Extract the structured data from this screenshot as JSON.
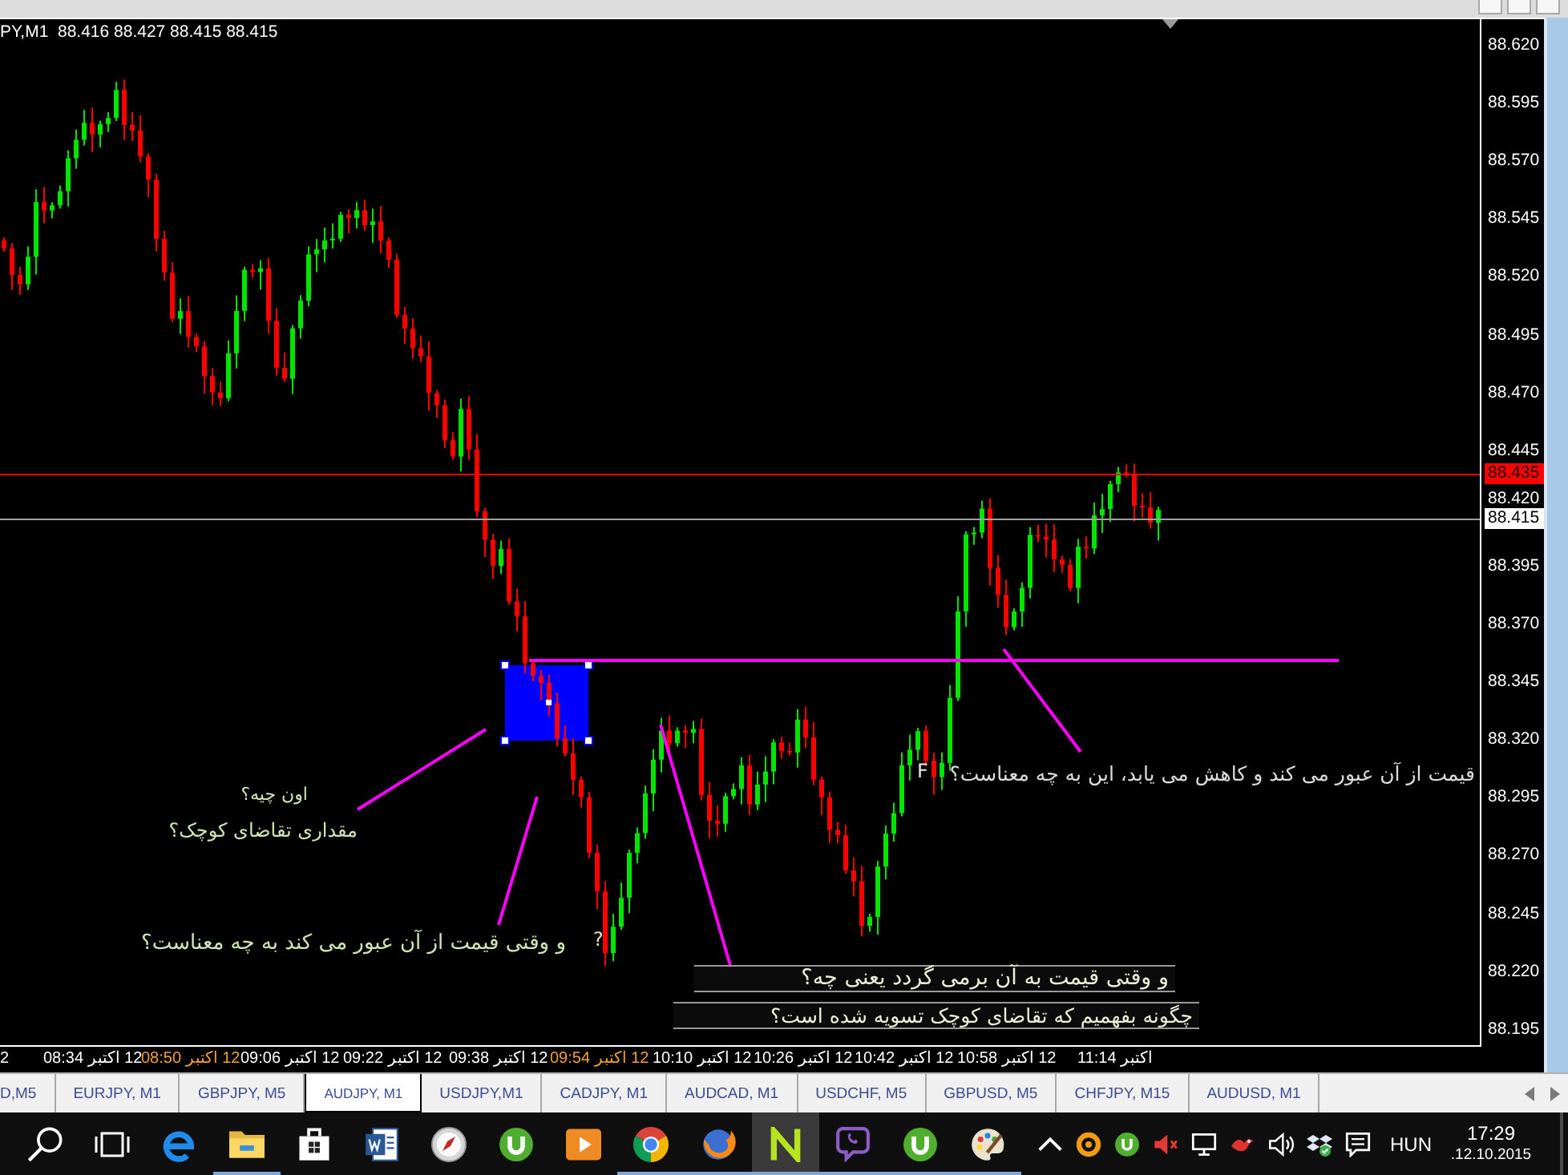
{
  "chart": {
    "title": "PY,M1  88.416 88.427 88.415 88.415",
    "price_ticks": [
      "88.620",
      "88.595",
      "88.570",
      "88.545",
      "88.520",
      "88.495",
      "88.470",
      "88.445",
      "88.420",
      "88.395",
      "88.370",
      "88.345",
      "88.320",
      "88.295",
      "88.270",
      "88.245",
      "88.220",
      "88.195"
    ],
    "price_markers": [
      {
        "kind": "level",
        "label": "88.435"
      },
      {
        "kind": "bid",
        "label": "88.415"
      }
    ],
    "time_labels": [
      {
        "label": "اکتبر 11:14",
        "highlighted": false
      },
      {
        "label": "12 اکتبر 10:58",
        "highlighted": false
      },
      {
        "label": "12 اکتبر 10:42",
        "highlighted": false
      },
      {
        "label": "12 اکتبر 10:26",
        "highlighted": false
      },
      {
        "label": "12 اکتبر 10:10",
        "highlighted": false
      },
      {
        "label": "12 اکتبر 09:54",
        "highlighted": true
      },
      {
        "label": "12 اکتبر 09:38",
        "highlighted": false
      },
      {
        "label": "12 اکتبر 09:22",
        "highlighted": false
      },
      {
        "label": "12 اکتبر 09:06",
        "highlighted": false
      },
      {
        "label": "12 اکتبر 08:50",
        "highlighted": true
      },
      {
        "label": "12 اکتبر 08:34",
        "highlighted": false
      },
      {
        "label": "2",
        "highlighted": false
      }
    ],
    "notes": [
      {
        "kind": "plain",
        "text": "قیمت از آن عبور می کند و کاهش می یابد، این به چه معناست؟"
      },
      {
        "kind": "plain",
        "text": "F"
      },
      {
        "kind": "plain",
        "text": "اون چیه؟"
      },
      {
        "kind": "plain",
        "text": "مقداری تقاضای کوچک؟"
      },
      {
        "kind": "plain",
        "text": "?"
      },
      {
        "kind": "plain",
        "text": "و وقتی قیمت از آن عبور می کند به چه معناست؟"
      },
      {
        "kind": "boxed",
        "text": "و وقتی قیمت به آن برمی گردد یعنی چه؟"
      },
      {
        "kind": "boxed",
        "text": "چگونه بفهمیم که تقاضای کوچک تسویه شده است؟"
      }
    ]
  },
  "tabs": [
    {
      "label": "AUDUSD, M1",
      "selected": false
    },
    {
      "label": "CHFJPY, M15",
      "selected": false
    },
    {
      "label": "GBPUSD, M5",
      "selected": false
    },
    {
      "label": "USDCHF, M5",
      "selected": false
    },
    {
      "label": "AUDCAD, M1",
      "selected": false
    },
    {
      "label": "CADJPY, M1",
      "selected": false
    },
    {
      "label": "USDJPY,M1",
      "selected": false
    },
    {
      "label": "AUDJPY, M1",
      "selected": true
    },
    {
      "label": "GBPJPY, M5",
      "selected": false
    },
    {
      "label": "EURJPY, M1",
      "selected": false
    },
    {
      "label": "D,M5",
      "selected": false
    }
  ],
  "taskbar": {
    "apps": [
      {
        "kind": "search",
        "running": false,
        "selected": false
      },
      {
        "kind": "task-view",
        "running": false,
        "selected": false
      },
      {
        "kind": "browser-e",
        "running": false,
        "selected": false
      },
      {
        "kind": "folder",
        "running": true,
        "selected": false
      },
      {
        "kind": "store",
        "running": false,
        "selected": false
      },
      {
        "kind": "document",
        "running": false,
        "selected": false
      },
      {
        "kind": "compass",
        "running": false,
        "selected": false
      },
      {
        "kind": "disc-logo",
        "running": false,
        "selected": false
      },
      {
        "kind": "media-player",
        "running": false,
        "selected": false
      },
      {
        "kind": "browser-ball",
        "running": true,
        "selected": false
      },
      {
        "kind": "browser-globe",
        "running": true,
        "selected": false
      },
      {
        "kind": "zigzag-logo",
        "running": true,
        "selected": true
      },
      {
        "kind": "phone-bubble",
        "running": true,
        "selected": false
      },
      {
        "kind": "disc-logo",
        "running": true,
        "selected": false
      },
      {
        "kind": "palette",
        "running": true,
        "selected": false
      }
    ],
    "language": "HUN",
    "time": "17:29",
    "date": ".12.10.2015"
  }
}
